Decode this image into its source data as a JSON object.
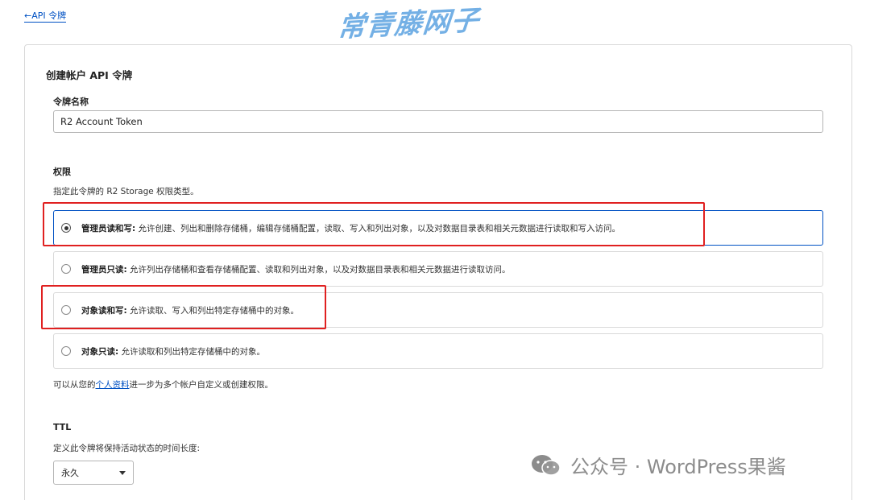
{
  "nav": {
    "back_label": "←API 令牌"
  },
  "watermark_top": "常青藤网子",
  "card": {
    "title": "创建帐户 API 令牌",
    "token_name": {
      "label": "令牌名称",
      "value": "R2 Account Token"
    },
    "permissions": {
      "title": "权限",
      "description": "指定此令牌的 R2 Storage 权限类型。",
      "options": [
        {
          "name": "管理员读和写:",
          "desc": " 允许创建、列出和删除存储桶，编辑存储桶配置，读取、写入和列出对象，以及对数据目录表和相关元数据进行读取和写入访问。",
          "selected": true
        },
        {
          "name": "管理员只读:",
          "desc": " 允许列出存储桶和查看存储桶配置、读取和列出对象，以及对数据目录表和相关元数据进行读取访问。",
          "selected": false
        },
        {
          "name": "对象读和写:",
          "desc": " 允许读取、写入和列出特定存储桶中的对象。",
          "selected": false
        },
        {
          "name": "对象只读:",
          "desc": " 允许读取和列出特定存储桶中的对象。",
          "selected": false
        }
      ],
      "note_prefix": "可以从您的",
      "note_link": "个人资料",
      "note_suffix": "进一步为多个帐户自定义或创建权限。"
    },
    "ttl": {
      "title": "TTL",
      "description": "定义此令牌将保持活动状态的时间长度:",
      "selected": "永久"
    }
  },
  "watermark_bottom": "公众号 · WordPress果酱",
  "colors": {
    "accent": "#0051c3",
    "highlight": "#e02020"
  }
}
